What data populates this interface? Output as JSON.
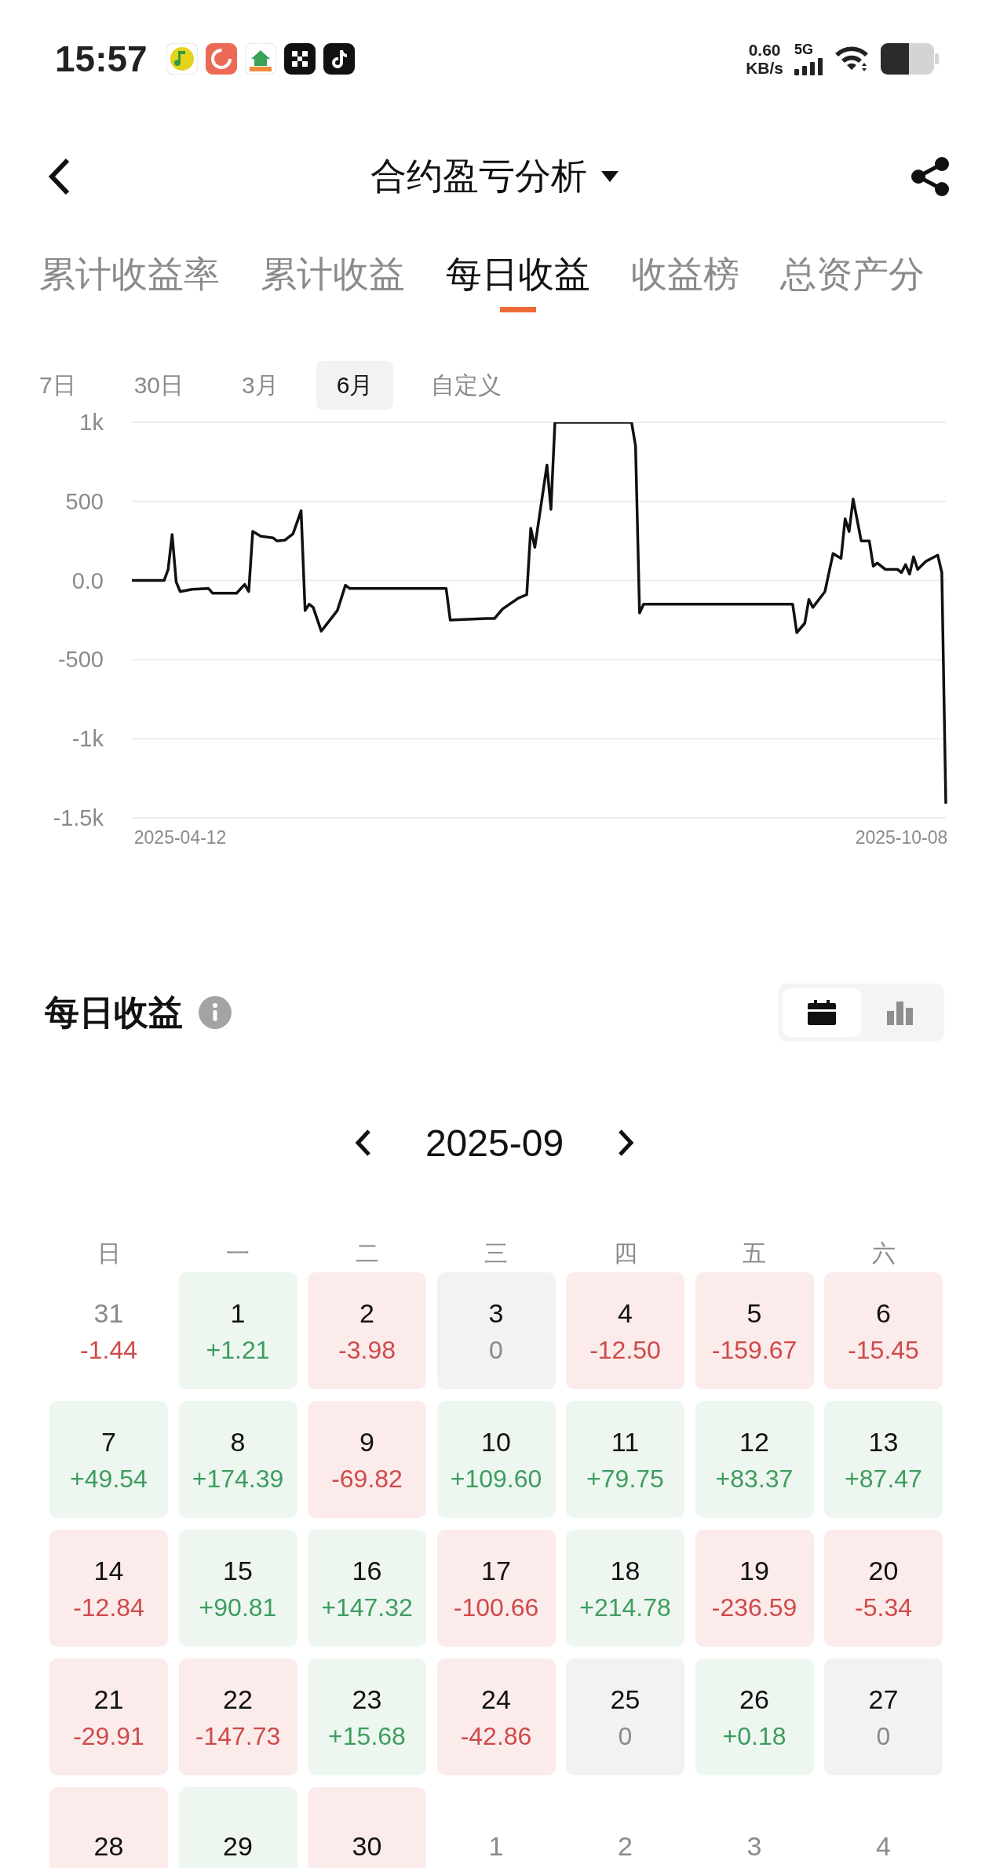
{
  "status_bar": {
    "time": "15:57",
    "net_speed": "0.60",
    "net_unit": "KB/s",
    "network": "5G"
  },
  "header": {
    "title": "合约盈亏分析"
  },
  "tabs": [
    {
      "label": "累计收益率",
      "selected": false
    },
    {
      "label": "累计收益",
      "selected": false
    },
    {
      "label": "每日收益",
      "selected": true
    },
    {
      "label": "收益榜",
      "selected": false
    },
    {
      "label": "总资产分",
      "selected": false
    }
  ],
  "ranges": [
    {
      "label": "7日",
      "selected": false
    },
    {
      "label": "30日",
      "selected": false
    },
    {
      "label": "3月",
      "selected": false
    },
    {
      "label": "6月",
      "selected": true
    },
    {
      "label": "自定义",
      "selected": false
    }
  ],
  "chart_data": {
    "type": "line",
    "grid": true,
    "ylim": [
      -1500,
      1000
    ],
    "xlim": [
      "2025-03-31",
      "2025-10-19"
    ],
    "yticks": [
      {
        "value": 1000,
        "label": "1k"
      },
      {
        "value": 500,
        "label": "500"
      },
      {
        "value": 0,
        "label": "0.0"
      },
      {
        "value": -500,
        "label": "-500"
      },
      {
        "value": -1000,
        "label": "-1k"
      },
      {
        "value": -1500,
        "label": "-1.5k"
      }
    ],
    "xticks": [
      "2025-04-12",
      "2025-10-08"
    ],
    "x": [
      "2025-03-31",
      "2025-04-08",
      "2025-04-09",
      "2025-04-10",
      "2025-04-11",
      "2025-04-12",
      "2025-04-15",
      "2025-04-19",
      "2025-04-20",
      "2025-04-26",
      "2025-04-28",
      "2025-04-29",
      "2025-04-30",
      "2025-05-02",
      "2025-05-05",
      "2025-05-06",
      "2025-05-08",
      "2025-05-10",
      "2025-05-12",
      "2025-05-13",
      "2025-05-14",
      "2025-05-15",
      "2025-05-17",
      "2025-05-21",
      "2025-05-23",
      "2025-05-24",
      "2025-06-17",
      "2025-06-18",
      "2025-06-27",
      "2025-06-29",
      "2025-07-01",
      "2025-07-05",
      "2025-07-07",
      "2025-07-08",
      "2025-07-09",
      "2025-07-12",
      "2025-07-13",
      "2025-07-14",
      "2025-08-02",
      "2025-08-03",
      "2025-08-04",
      "2025-08-05",
      "2025-09-11",
      "2025-09-12",
      "2025-09-14",
      "2025-09-15",
      "2025-09-16",
      "2025-09-19",
      "2025-09-21",
      "2025-09-23",
      "2025-09-24",
      "2025-09-25",
      "2025-09-26",
      "2025-09-28",
      "2025-09-30",
      "2025-10-01",
      "2025-10-02",
      "2025-10-04",
      "2025-10-07",
      "2025-10-08",
      "2025-10-09",
      "2025-10-10",
      "2025-10-11",
      "2025-10-12",
      "2025-10-14",
      "2025-10-17",
      "2025-10-18",
      "2025-10-19"
    ],
    "series": [
      {
        "color": "#111111",
        "values": [
          0,
          0,
          70,
          290,
          -10,
          -70,
          -55,
          -50,
          -80,
          -80,
          -25,
          -70,
          310,
          280,
          270,
          250,
          255,
          295,
          440,
          -190,
          -150,
          -170,
          -320,
          -190,
          -30,
          -50,
          -50,
          -250,
          -240,
          -240,
          -180,
          -110,
          -90,
          330,
          210,
          730,
          450,
          1000,
          1000,
          850,
          -205,
          -150,
          -150,
          -330,
          -270,
          -120,
          -170,
          -70,
          170,
          140,
          390,
          310,
          515,
          250,
          250,
          90,
          110,
          70,
          70,
          50,
          100,
          40,
          150,
          70,
          120,
          160,
          50,
          -1410
        ]
      }
    ]
  },
  "section": {
    "title": "每日收益"
  },
  "view_toggle": [
    {
      "kind": "calendar",
      "selected": true
    },
    {
      "kind": "bars",
      "selected": false
    }
  ],
  "calendar": {
    "month": "2025-09",
    "weekdays": [
      "日",
      "一",
      "二",
      "三",
      "四",
      "五",
      "六"
    ],
    "days": [
      {
        "day": "31",
        "value": "-1.44",
        "kind": "loss",
        "in_month": false
      },
      {
        "day": "1",
        "value": "+1.21",
        "kind": "gain",
        "in_month": true
      },
      {
        "day": "2",
        "value": "-3.98",
        "kind": "loss",
        "in_month": true
      },
      {
        "day": "3",
        "value": "0",
        "kind": "flat",
        "in_month": true
      },
      {
        "day": "4",
        "value": "-12.50",
        "kind": "loss",
        "in_month": true
      },
      {
        "day": "5",
        "value": "-159.67",
        "kind": "loss",
        "in_month": true
      },
      {
        "day": "6",
        "value": "-15.45",
        "kind": "loss",
        "in_month": true
      },
      {
        "day": "7",
        "value": "+49.54",
        "kind": "gain",
        "in_month": true
      },
      {
        "day": "8",
        "value": "+174.39",
        "kind": "gain",
        "in_month": true
      },
      {
        "day": "9",
        "value": "-69.82",
        "kind": "loss",
        "in_month": true
      },
      {
        "day": "10",
        "value": "+109.60",
        "kind": "gain",
        "in_month": true
      },
      {
        "day": "11",
        "value": "+79.75",
        "kind": "gain",
        "in_month": true
      },
      {
        "day": "12",
        "value": "+83.37",
        "kind": "gain",
        "in_month": true
      },
      {
        "day": "13",
        "value": "+87.47",
        "kind": "gain",
        "in_month": true
      },
      {
        "day": "14",
        "value": "-12.84",
        "kind": "loss",
        "in_month": true
      },
      {
        "day": "15",
        "value": "+90.81",
        "kind": "gain",
        "in_month": true
      },
      {
        "day": "16",
        "value": "+147.32",
        "kind": "gain",
        "in_month": true
      },
      {
        "day": "17",
        "value": "-100.66",
        "kind": "loss",
        "in_month": true
      },
      {
        "day": "18",
        "value": "+214.78",
        "kind": "gain",
        "in_month": true
      },
      {
        "day": "19",
        "value": "-236.59",
        "kind": "loss",
        "in_month": true
      },
      {
        "day": "20",
        "value": "-5.34",
        "kind": "loss",
        "in_month": true
      },
      {
        "day": "21",
        "value": "-29.91",
        "kind": "loss",
        "in_month": true
      },
      {
        "day": "22",
        "value": "-147.73",
        "kind": "loss",
        "in_month": true
      },
      {
        "day": "23",
        "value": "+15.68",
        "kind": "gain",
        "in_month": true
      },
      {
        "day": "24",
        "value": "-42.86",
        "kind": "loss",
        "in_month": true
      },
      {
        "day": "25",
        "value": "0",
        "kind": "flat",
        "in_month": true
      },
      {
        "day": "26",
        "value": "+0.18",
        "kind": "gain",
        "in_month": true
      },
      {
        "day": "27",
        "value": "0",
        "kind": "flat",
        "in_month": true
      },
      {
        "day": "28",
        "kind": "loss",
        "in_month": true
      },
      {
        "day": "29",
        "kind": "gain",
        "in_month": true
      },
      {
        "day": "30",
        "kind": "loss",
        "in_month": true
      },
      {
        "day": "1",
        "in_month": false
      },
      {
        "day": "2",
        "in_month": false
      },
      {
        "day": "3",
        "in_month": false
      },
      {
        "day": "4",
        "in_month": false
      }
    ]
  }
}
